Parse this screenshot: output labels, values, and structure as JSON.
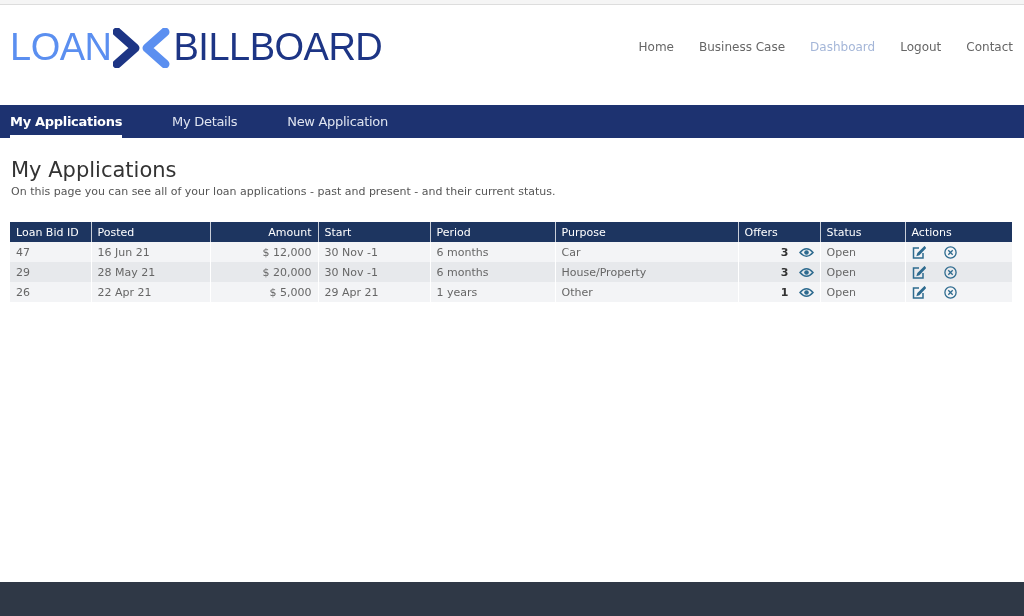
{
  "logo": {
    "left": "LOAN",
    "right": "BILLBOARD"
  },
  "nav": [
    {
      "label": "Home",
      "selected": false
    },
    {
      "label": "Business Case",
      "selected": false
    },
    {
      "label": "Dashboard",
      "selected": true
    },
    {
      "label": "Logout",
      "selected": false
    },
    {
      "label": "Contact",
      "selected": false
    }
  ],
  "tabs": [
    {
      "label": "My Applications",
      "selected": true
    },
    {
      "label": "My Details",
      "selected": false
    },
    {
      "label": "New Application",
      "selected": false
    }
  ],
  "heading": "My Applications",
  "intro": "On this page you can see all of your loan applications - past and present - and their current status.",
  "table": {
    "columns": [
      "Loan Bid ID",
      "Posted",
      "Amount",
      "Start",
      "Period",
      "Purpose",
      "Offers",
      "Status",
      "Actions"
    ],
    "rows": [
      {
        "id": "47",
        "posted": "16 Jun 21",
        "amount": "$ 12,000",
        "start": "30 Nov -1",
        "period": "6  months",
        "purpose": "Car",
        "offers": "3",
        "status": "Open"
      },
      {
        "id": "29",
        "posted": "28 May 21",
        "amount": "$ 20,000",
        "start": "30 Nov -1",
        "period": "6  months",
        "purpose": "House/Property",
        "offers": "3",
        "status": "Open"
      },
      {
        "id": "26",
        "posted": "22 Apr 21",
        "amount": "$ 5,000",
        "start": "29 Apr 21",
        "period": "1  years",
        "purpose": "Other",
        "offers": "1",
        "status": "Open"
      }
    ]
  }
}
